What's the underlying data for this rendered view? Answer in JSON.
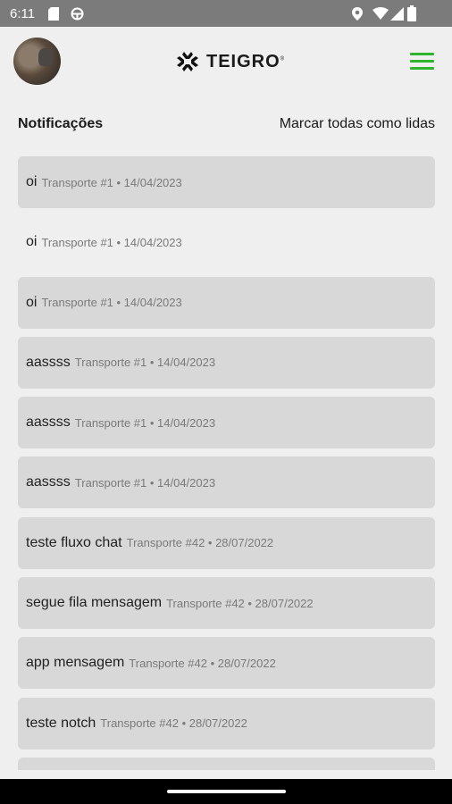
{
  "status_bar": {
    "time": "6:11",
    "left_icons": [
      "sd-card-icon",
      "at-sign-icon"
    ],
    "right_icons": [
      "location-icon",
      "wifi-icon",
      "signal-icon",
      "battery-icon"
    ]
  },
  "app_bar": {
    "brand": "TEIGRO",
    "menu_color": "#2db52d"
  },
  "notifications": {
    "title": "Notificações",
    "mark_all_label": "Marcar todas como lidas",
    "items": [
      {
        "message": "oi",
        "meta": "Transporte #1 • 14/04/2023",
        "unread": true
      },
      {
        "message": "oi",
        "meta": "Transporte #1 • 14/04/2023",
        "unread": false
      },
      {
        "message": "oi",
        "meta": "Transporte #1 • 14/04/2023",
        "unread": true
      },
      {
        "message": "aassss",
        "meta": "Transporte #1 • 14/04/2023",
        "unread": true
      },
      {
        "message": "aassss",
        "meta": "Transporte #1 • 14/04/2023",
        "unread": true
      },
      {
        "message": "aassss",
        "meta": "Transporte #1 • 14/04/2023",
        "unread": true
      },
      {
        "message": "teste fluxo chat",
        "meta": "Transporte #42 • 28/07/2022",
        "unread": true
      },
      {
        "message": "segue fila mensagem",
        "meta": "Transporte #42 • 28/07/2022",
        "unread": true
      },
      {
        "message": "app mensagem",
        "meta": "Transporte #42 • 28/07/2022",
        "unread": true
      },
      {
        "message": "teste notch",
        "meta": "Transporte #42 • 28/07/2022",
        "unread": true
      },
      {
        "message": "",
        "meta": "",
        "unread": true
      }
    ]
  }
}
